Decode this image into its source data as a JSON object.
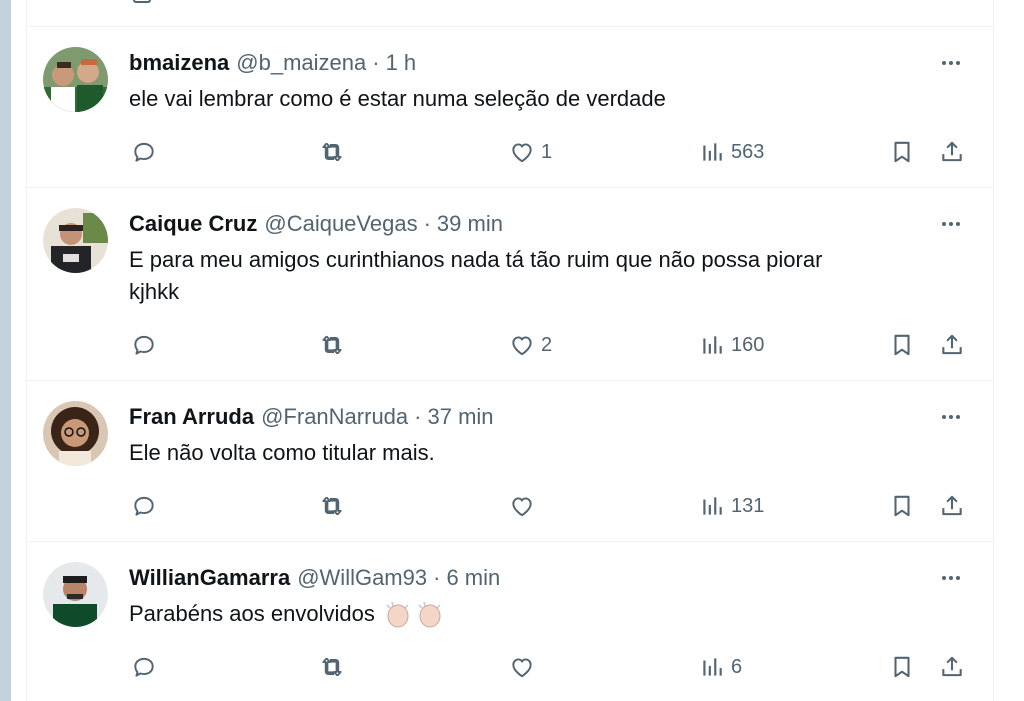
{
  "tweets": [
    {
      "name": "bmaizena",
      "handle": "@b_maizena",
      "separator": "·",
      "time": "1 h",
      "text": "ele vai lembrar como é estar numa seleção de verdade",
      "text2": "",
      "likes": "1",
      "views": "563"
    },
    {
      "name": "Caique Cruz",
      "handle": "@CaiqueVegas",
      "separator": "·",
      "time": "39 min",
      "text": "E para meu amigos curinthianos nada tá tão ruim que não possa piorar",
      "text2": "kjhkk",
      "likes": "2",
      "views": "160"
    },
    {
      "name": "Fran Arruda",
      "handle": "@FranNarruda",
      "separator": "·",
      "time": "37 min",
      "text": "Ele não volta como titular mais.",
      "text2": "",
      "likes": "",
      "views": "131"
    },
    {
      "name": "WillianGamarra",
      "handle": "@WillGam93",
      "separator": "·",
      "time": "6 min",
      "text": "Parabéns aos envolvidos",
      "text2": "",
      "likes": "",
      "views": "6"
    }
  ],
  "icons": {
    "reply": "reply-icon",
    "retweet": "retweet-icon",
    "like": "heart-icon",
    "views": "views-chart-icon",
    "bookmark": "bookmark-icon",
    "share": "share-icon",
    "more": "more-dots-icon",
    "emoji": "clapping-hands-emoji"
  },
  "colors": {
    "icon": "#536471",
    "text": "#0f1419",
    "secondary": "#536471",
    "divider": "#eff3f4",
    "left_rail": "#c3d2dd"
  }
}
